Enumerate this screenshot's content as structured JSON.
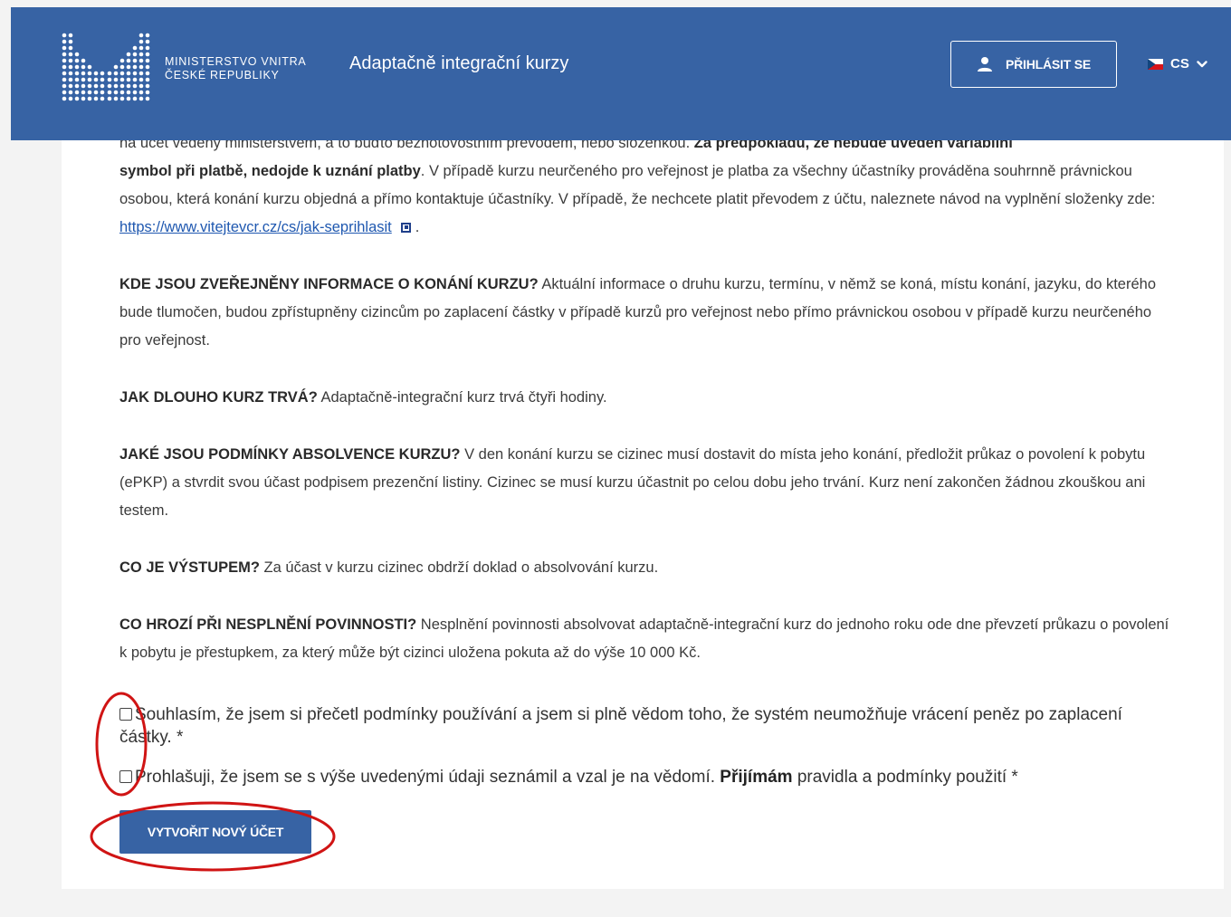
{
  "header": {
    "logo_line1": "MINISTERSTVO VNITRA",
    "logo_line2": "ČESKÉ REPUBLIKY",
    "app_title": "Adaptačně integrační kurzy",
    "login_label": "PŘIHLÁSIT SE",
    "language": "CS"
  },
  "content": {
    "para1": {
      "line_partial": "na účet vedený ministerstvem, a to buďto bezhotovostním převodem, nebo složenkou.",
      "bold_partial": "Za předpokladu, že nebude uveden variabilní",
      "bold2": "symbol při platbě, nedojde k uznání platby",
      "text": ". V případě kurzu neurčeného pro veřejnost je platba za všechny účastníky prováděna souhrnně právnickou osobou, která konání kurzu objedná a přímo kontaktuje účastníky. V případě, že nechcete platit převodem z účtu, naleznete návod na vyplnění složenky zde:",
      "link": "https://www.vitejtevcr.cz/cs/jak-seprihlasit",
      "end": "."
    },
    "sections": [
      {
        "q": "KDE JSOU ZVEŘEJNĚNY INFORMACE O KONÁNÍ KURZU?",
        "a": "Aktuální informace o druhu kurzu, termínu, v němž se koná, místu konání, jazyku, do kterého bude tlumočen, budou zpřístupněny cizincům po zaplacení částky v případě kurzů pro veřejnost nebo přímo právnickou osobou v případě kurzu neurčeného pro veřejnost."
      },
      {
        "q": "JAK DLOUHO KURZ TRVÁ?",
        "a": "Adaptačně-integrační kurz trvá čtyři hodiny."
      },
      {
        "q": "JAKÉ JSOU PODMÍNKY ABSOLVENCE KURZU?",
        "a": "V den konání kurzu se cizinec musí dostavit do místa jeho konání, předložit průkaz o povolení k pobytu (ePKP) a stvrdit svou účast podpisem prezenční listiny. Cizinec se musí kurzu účastnit po celou dobu jeho trvání. Kurz není zakončen žádnou zkouškou ani testem."
      },
      {
        "q": "CO JE VÝSTUPEM?",
        "a": "Za účast v kurzu cizinec obdrží doklad o absolvování kurzu."
      },
      {
        "q": "CO HROZÍ PŘI NESPLNĚNÍ POVINNOSTI?",
        "a": "Nesplnění povinnosti absolvovat adaptačně-integrační kurz do jednoho roku ode dne převzetí průkazu o povolení k pobytu je přestupkem, za který může být cizinci uložena pokuta až do výše 10 000 Kč."
      }
    ]
  },
  "consent": {
    "terms_label": "Souhlasím, že jsem si přečetl podmínky používání a jsem si plně vědom toho, že systém neumožňuje vrácení peněz po zaplacení částky. *",
    "declare_prefix": "Prohlašuji, že jsem se s výše uvedenými údaji seznámil a vzal je na vědomí.",
    "declare_bold": "Přijímám",
    "declare_suffix": "pravidla a podmínky použití *"
  },
  "actions": {
    "create_label": "VYTVOŘIT NOVÝ ÚČET"
  },
  "colors": {
    "header_bg": "#3763a4",
    "button_bg": "#3763a4",
    "annotation": "#d01414",
    "link": "#1f58b0"
  }
}
